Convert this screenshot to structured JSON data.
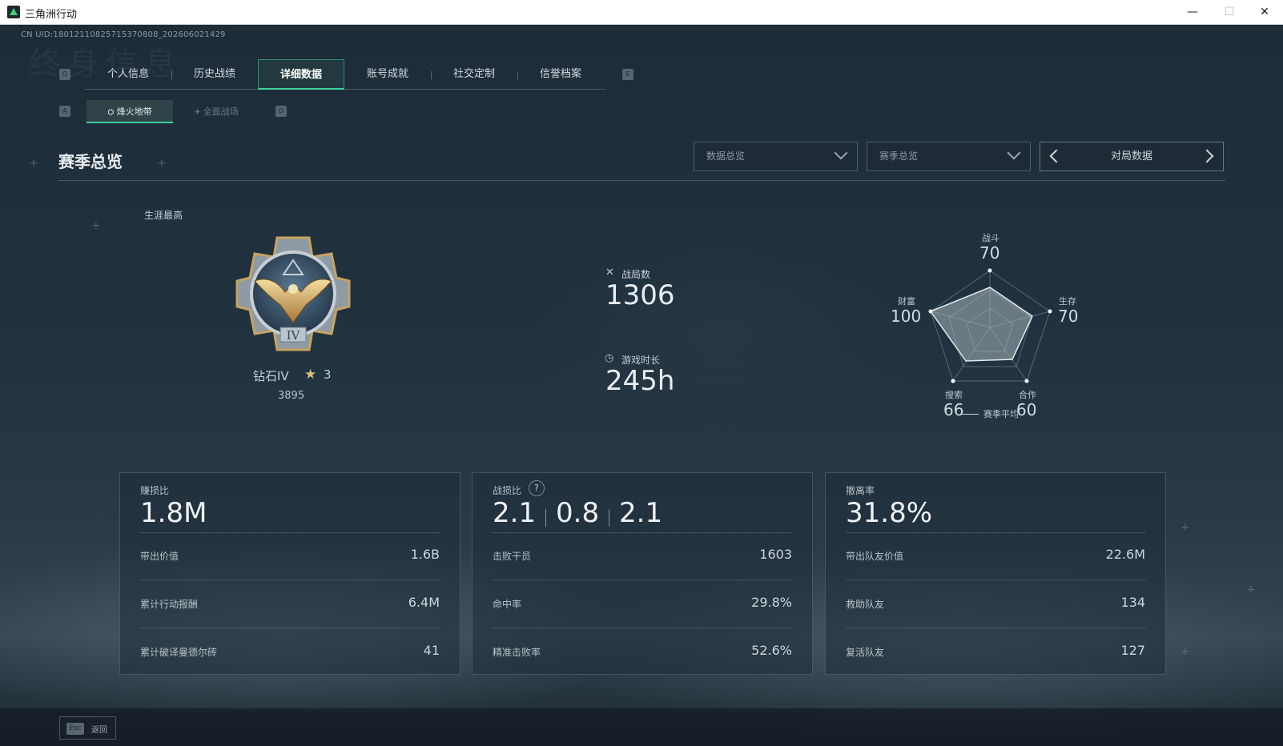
{
  "window": {
    "title": "三角洲行动",
    "minimize": "—",
    "maximize": "☐",
    "close": "✕"
  },
  "uid": "CN UID:18012110825715370808_202606021429",
  "watermark": "终身信息",
  "main_tabs": {
    "prev_key": "Q",
    "next_key": "E",
    "items": [
      "个人信息",
      "历史战绩",
      "详细数据",
      "账号成就",
      "社交定制",
      "信誉档案"
    ],
    "active": "详细数据"
  },
  "sub_tabs": {
    "prev_key": "A",
    "next_key": "D",
    "items": [
      {
        "label": "烽火地带",
        "icon": "helicopter-icon"
      },
      {
        "label": "全面战场",
        "icon": "jet-icon"
      }
    ],
    "active": "烽火地带"
  },
  "section": {
    "title": "赛季总览"
  },
  "filters": {
    "dropdown1": "数据总览",
    "dropdown2": "赛季总览",
    "pager_label": "对局数据"
  },
  "rank": {
    "career_label": "生涯最高",
    "name": "钻石IV",
    "stars": "3",
    "score": "3895"
  },
  "stats": {
    "matches_label": "战局数",
    "matches_value": "1306",
    "playtime_label": "游戏时长",
    "playtime_value": "245h"
  },
  "radar": {
    "axes": [
      {
        "label": "战斗",
        "value": "70"
      },
      {
        "label": "生存",
        "value": "70"
      },
      {
        "label": "合作",
        "value": "60"
      },
      {
        "label": "搜索",
        "value": "66"
      },
      {
        "label": "财富",
        "value": "100"
      }
    ],
    "legend": "赛季平均"
  },
  "panels": [
    {
      "title": "赚损比",
      "value": "1.8M",
      "rows": [
        {
          "label": "带出价值",
          "value": "1.6B"
        },
        {
          "label": "累计行动报酬",
          "value": "6.4M"
        },
        {
          "label": "累计破译曼德尔砖",
          "value": "41"
        }
      ]
    },
    {
      "title": "战损比",
      "values": [
        "2.1",
        "0.8",
        "2.1"
      ],
      "help": "?",
      "rows": [
        {
          "label": "击败干员",
          "value": "1603"
        },
        {
          "label": "命中率",
          "value": "29.8%"
        },
        {
          "label": "精准击败率",
          "value": "52.6%"
        }
      ]
    },
    {
      "title": "撤离率",
      "value": "31.8%",
      "rows": [
        {
          "label": "带出队友价值",
          "value": "22.6M"
        },
        {
          "label": "救助队友",
          "value": "134"
        },
        {
          "label": "复活队友",
          "value": "127"
        }
      ]
    }
  ],
  "footer": {
    "esc_key": "Esc",
    "back_label": "返回"
  }
}
